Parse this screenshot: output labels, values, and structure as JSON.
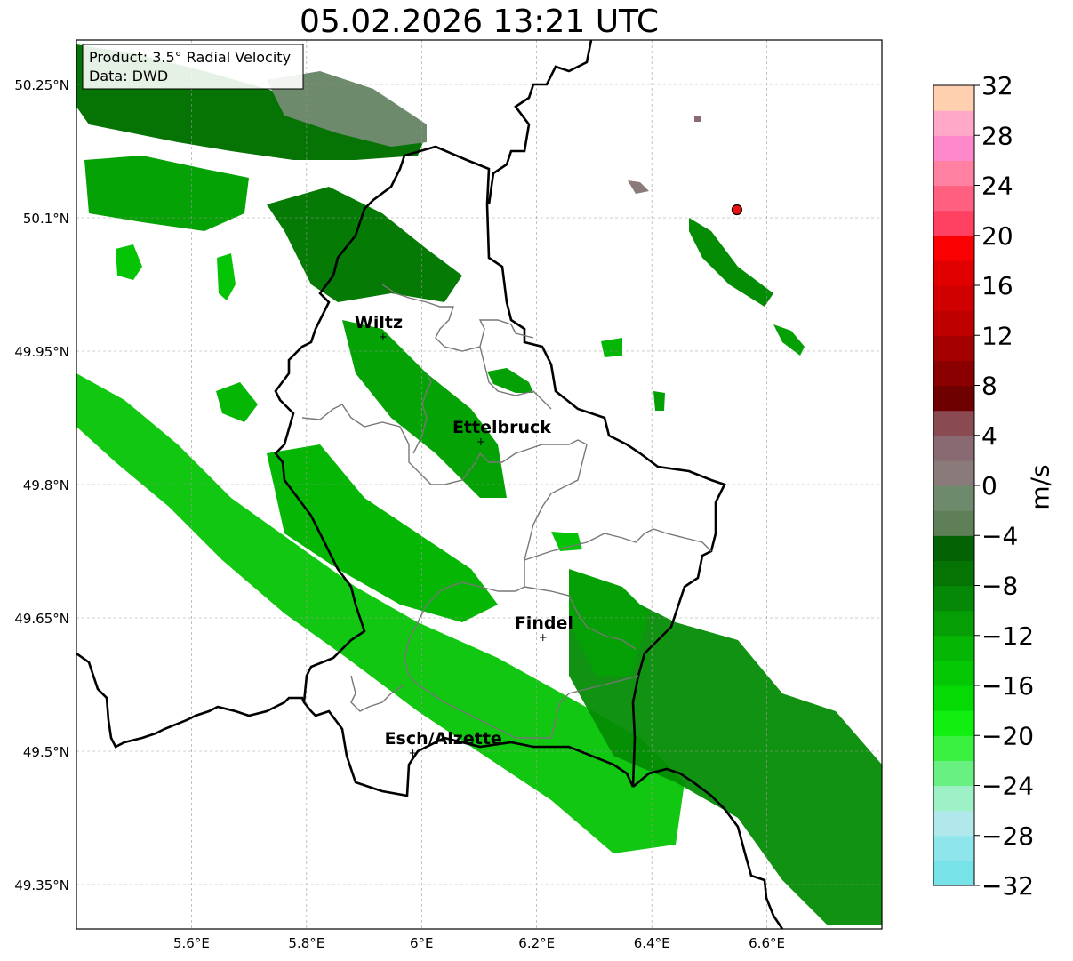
{
  "title": "05.02.2026 13:21 UTC",
  "info_box": {
    "product": "Product: 3.5° Radial Velocity",
    "data": "Data: DWD"
  },
  "axes": {
    "lon_range": [
      5.4,
      6.8
    ],
    "lat_range": [
      49.3,
      50.3
    ],
    "x_ticks": [
      {
        "value": 5.6,
        "label": "5.6°E"
      },
      {
        "value": 5.8,
        "label": "5.8°E"
      },
      {
        "value": 6.0,
        "label": "6°E"
      },
      {
        "value": 6.2,
        "label": "6.2°E"
      },
      {
        "value": 6.4,
        "label": "6.4°E"
      },
      {
        "value": 6.6,
        "label": "6.6°E"
      }
    ],
    "y_ticks": [
      {
        "value": 50.25,
        "label": "50.25°N"
      },
      {
        "value": 50.1,
        "label": "50.1°N"
      },
      {
        "value": 49.95,
        "label": "49.95°N"
      },
      {
        "value": 49.8,
        "label": "49.8°N"
      },
      {
        "value": 49.65,
        "label": "49.65°N"
      },
      {
        "value": 49.5,
        "label": "49.5°N"
      },
      {
        "value": 49.35,
        "label": "49.35°N"
      }
    ]
  },
  "cities": [
    {
      "name": "Wiltz",
      "lon": 5.933,
      "lat": 49.966
    },
    {
      "name": "Ettelbruck",
      "lon": 6.103,
      "lat": 49.848
    },
    {
      "name": "Findel",
      "lon": 6.211,
      "lat": 49.628
    },
    {
      "name": "Esch/Alzette",
      "lon": 5.985,
      "lat": 49.498
    }
  ],
  "radar_site": {
    "lon": 6.548,
    "lat": 50.109
  },
  "colorbar": {
    "label": "m/s",
    "min": -32,
    "max": 32,
    "ticks": [
      {
        "value": 32,
        "label": "32"
      },
      {
        "value": 28,
        "label": "28"
      },
      {
        "value": 24,
        "label": "24"
      },
      {
        "value": 20,
        "label": "20"
      },
      {
        "value": 16,
        "label": "16"
      },
      {
        "value": 12,
        "label": "12"
      },
      {
        "value": 8,
        "label": "8"
      },
      {
        "value": 4,
        "label": "4"
      },
      {
        "value": 0,
        "label": "0"
      },
      {
        "value": -4,
        "label": "−4"
      },
      {
        "value": -8,
        "label": "−8"
      },
      {
        "value": -12,
        "label": "−12"
      },
      {
        "value": -16,
        "label": "−16"
      },
      {
        "value": -20,
        "label": "−20"
      },
      {
        "value": -24,
        "label": "−24"
      },
      {
        "value": -28,
        "label": "−28"
      },
      {
        "value": -32,
        "label": "−32"
      }
    ],
    "colors": [
      "#77e2e8",
      "#8ee6ec",
      "#b0e8ec",
      "#9ef0c6",
      "#68f080",
      "#3af040",
      "#10ef10",
      "#05da05",
      "#05c805",
      "#05b605",
      "#059e05",
      "#058805",
      "#057405",
      "#036203",
      "#5e7f57",
      "#6e8a6c",
      "#8a7a7a",
      "#8a6a72",
      "#8a4a52",
      "#6e0000",
      "#8a0000",
      "#a40000",
      "#be0000",
      "#d00000",
      "#e00000",
      "#fa0000",
      "#ff4060",
      "#ff6080",
      "#ff80a0",
      "#ff88cc",
      "#ffa8c8",
      "#ffd0b0"
    ]
  }
}
